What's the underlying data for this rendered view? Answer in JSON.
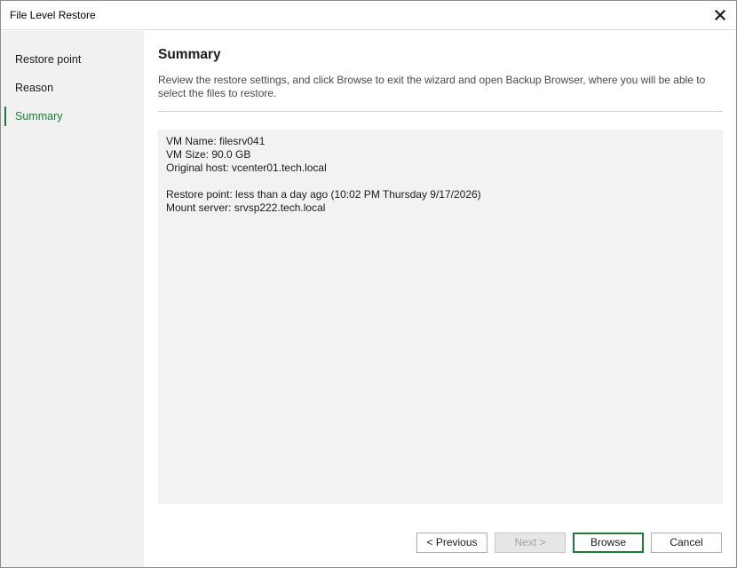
{
  "window": {
    "title": "File Level Restore",
    "close_icon": "close-icon"
  },
  "sidebar": {
    "items": [
      {
        "label": "Restore point",
        "active": false
      },
      {
        "label": "Reason",
        "active": false
      },
      {
        "label": "Summary",
        "active": true
      }
    ]
  },
  "main": {
    "heading": "Summary",
    "description": "Review the restore settings, and click Browse to exit the wizard and open Backup Browser, where you will be able to select the files to restore.",
    "summary_lines": [
      "VM Name: filesrv041",
      "VM Size: 90.0 GB",
      "Original host: vcenter01.tech.local",
      "",
      "Restore point: less than a day ago (10:02 PM Thursday 9/17/2026)",
      "Mount server: srvsp222.tech.local"
    ]
  },
  "buttons": {
    "previous": "< Previous",
    "next": "Next >",
    "browse": "Browse",
    "cancel": "Cancel"
  },
  "colors": {
    "accent": "#1e7a3c",
    "sidebar_bg": "#f1f1f1",
    "summary_bg": "#f1f2f1"
  }
}
